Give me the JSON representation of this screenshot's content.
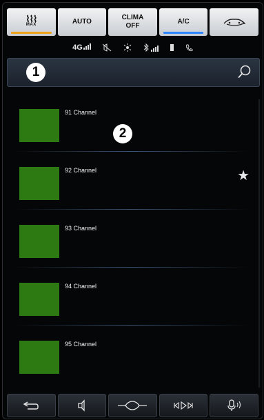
{
  "climate": {
    "defrost": {
      "wave": "⌇⌇⌇",
      "label": "MAX"
    },
    "auto": "AUTO",
    "clima_off": "CLIMA\nOFF",
    "ac": "A/C",
    "recirc_icon": "recirculation-icon"
  },
  "status": {
    "network": "4G",
    "icons": [
      "signal-icon",
      "mute-icon",
      "gps-icon",
      "bluetooth-icon",
      "battery-icon",
      "phone-icon"
    ]
  },
  "search": {
    "value": "",
    "placeholder": ""
  },
  "callouts": {
    "one": "1",
    "two": "2"
  },
  "channels": [
    {
      "name": "91 Channel",
      "favorite": false
    },
    {
      "name": "92 Channel",
      "favorite": true
    },
    {
      "name": "93 Channel",
      "favorite": false
    },
    {
      "name": "94 Channel",
      "favorite": false
    },
    {
      "name": "95 Channel",
      "favorite": false
    }
  ],
  "favorite_glyph": "★",
  "nav": {
    "back_icon": "back-icon",
    "speaker_icon": "speaker-icon",
    "home_icon": "home-icon",
    "media_icon": "media-controls-icon",
    "voice_icon": "voice-icon"
  },
  "colors": {
    "amber_indicator": "#f0a11a",
    "blue_indicator": "#2e86ff",
    "thumb_green": "#2d7a12"
  }
}
